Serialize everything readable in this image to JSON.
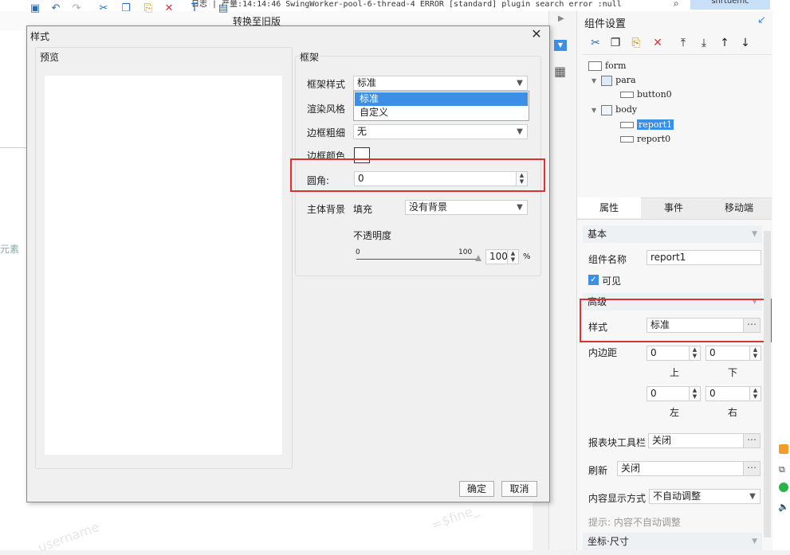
{
  "background": {
    "log_text": "日志 | 产量:14:14:46 SwingWorker-pool-6-thread-4 ERROR [standard] plugin search error :null",
    "user_tab": "snrtuemc",
    "toolbar_convert_label": "转换至旧版",
    "side_text": "元素",
    "watermark_1": "username",
    "watermark_2": "=$fine_"
  },
  "dialog": {
    "title": "样式",
    "preview_label": "预览",
    "frame_label": "框架",
    "frame_style_label": "框架样式",
    "frame_style_value": "标准",
    "dropdown_options": [
      "标准",
      "自定义"
    ],
    "render_style_label": "渲染风格",
    "border_width_label": "边框粗细",
    "border_width_value": "无",
    "border_color_label": "边框颜色",
    "corner_label": "圆角:",
    "corner_value": "0",
    "body_bg_label": "主体背景",
    "fill_label": "填充",
    "fill_value": "没有背景",
    "opacity_label": "不透明度",
    "slider_min": "0",
    "slider_max": "100",
    "opacity_value": "100",
    "percent": "%",
    "ok_button": "确定",
    "cancel_button": "取消"
  },
  "right_panel": {
    "title": "组件设置",
    "tree": {
      "form": "form",
      "para": "para",
      "button0": "button0",
      "body": "body",
      "report1": "report1",
      "report0": "report0"
    },
    "tabs": [
      "属性",
      "事件",
      "移动端"
    ],
    "basic_section": "基本",
    "component_name_label": "组件名称",
    "component_name_value": "report1",
    "visible_label": "可见",
    "advanced_section": "高级",
    "style_label": "样式",
    "style_value": "标准",
    "padding_label": "内边距",
    "padding_top": "0",
    "padding_bottom": "0",
    "padding_left": "0",
    "padding_right": "0",
    "top_label": "上",
    "bottom_label": "下",
    "left_label": "左",
    "right_label": "右",
    "toolbar_label": "报表块工具栏",
    "toolbar_value": "关闭",
    "refresh_label": "刷新",
    "refresh_value": "关闭",
    "display_mode_label": "内容显示方式",
    "display_mode_value": "不自动调整",
    "hint_text": "提示: 内容不自动调整",
    "coords_section": "坐标·尺寸"
  },
  "colors": {
    "accent": "#3d8fe5",
    "highlight_box": "#e03131",
    "delete_icon": "#d9333f"
  }
}
